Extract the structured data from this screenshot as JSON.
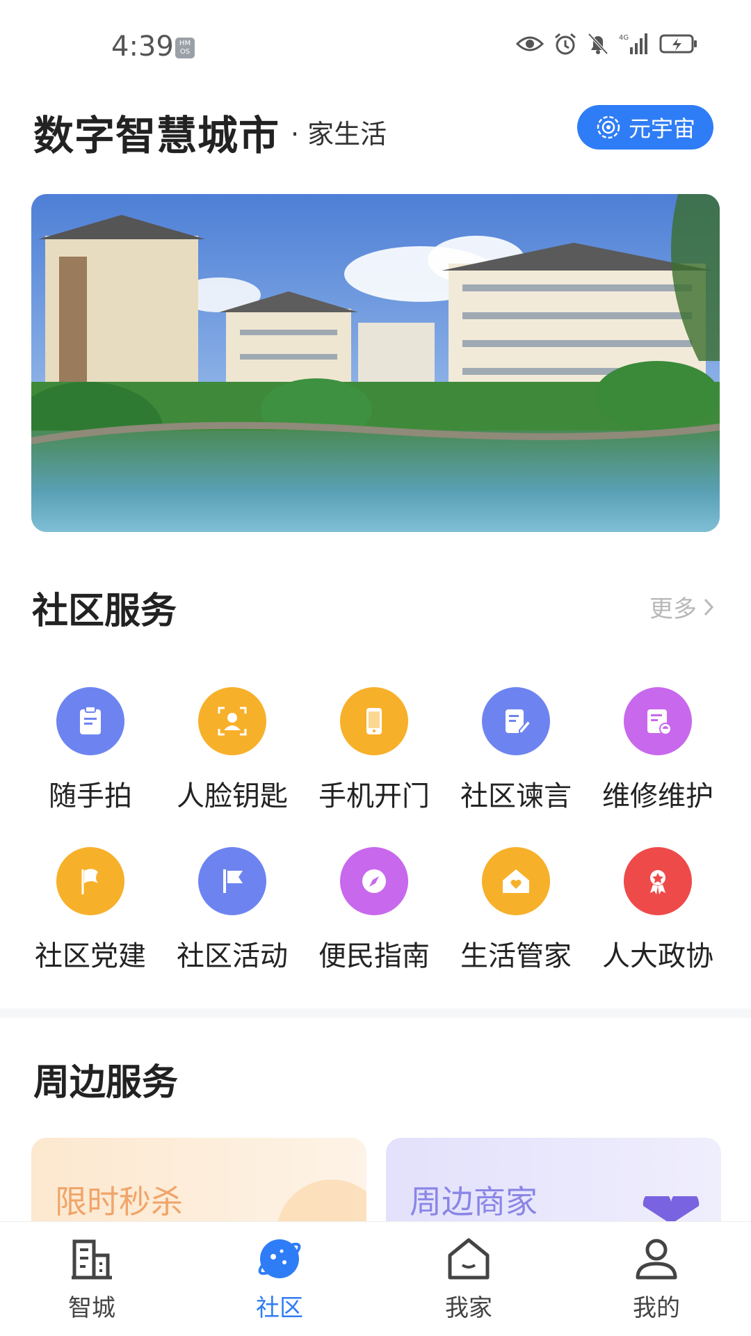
{
  "status_bar": {
    "time": "4:39",
    "os_badge": "HM OS",
    "network": "4G"
  },
  "header": {
    "title": "数字智慧城市",
    "subtitle": "家生活",
    "meta_button": "元宇宙"
  },
  "community_services": {
    "title": "社区服务",
    "more_label": "更多",
    "items": [
      {
        "label": "随手拍",
        "icon": "clipboard-icon",
        "color": "#6d84f0"
      },
      {
        "label": "人脸钥匙",
        "icon": "face-id-icon",
        "color": "#f7b02a"
      },
      {
        "label": "手机开门",
        "icon": "phone-icon",
        "color": "#f7b02a"
      },
      {
        "label": "社区谏言",
        "icon": "note-edit-icon",
        "color": "#6d84f0"
      },
      {
        "label": "维修维护",
        "icon": "repair-doc-icon",
        "color": "#c868ec"
      },
      {
        "label": "社区党建",
        "icon": "flag-icon",
        "color": "#f7b02a"
      },
      {
        "label": "社区活动",
        "icon": "banner-flag-icon",
        "color": "#6d84f0"
      },
      {
        "label": "便民指南",
        "icon": "compass-icon",
        "color": "#c868ec"
      },
      {
        "label": "生活管家",
        "icon": "home-heart-icon",
        "color": "#f7b02a"
      },
      {
        "label": "人大政协",
        "icon": "medal-icon",
        "color": "#ee4a4a"
      }
    ]
  },
  "nearby_services": {
    "title": "周边服务",
    "cards": [
      {
        "label": "限时秒杀",
        "color": "#f0a56a"
      },
      {
        "label": "周边商家",
        "color": "#8a86e6"
      }
    ]
  },
  "bottom_nav": {
    "items": [
      {
        "label": "智城",
        "icon": "building-icon"
      },
      {
        "label": "社区",
        "icon": "planet-icon",
        "active": true
      },
      {
        "label": "我家",
        "icon": "house-icon"
      },
      {
        "label": "我的",
        "icon": "person-icon"
      }
    ],
    "active_color": "#2f7df6"
  }
}
